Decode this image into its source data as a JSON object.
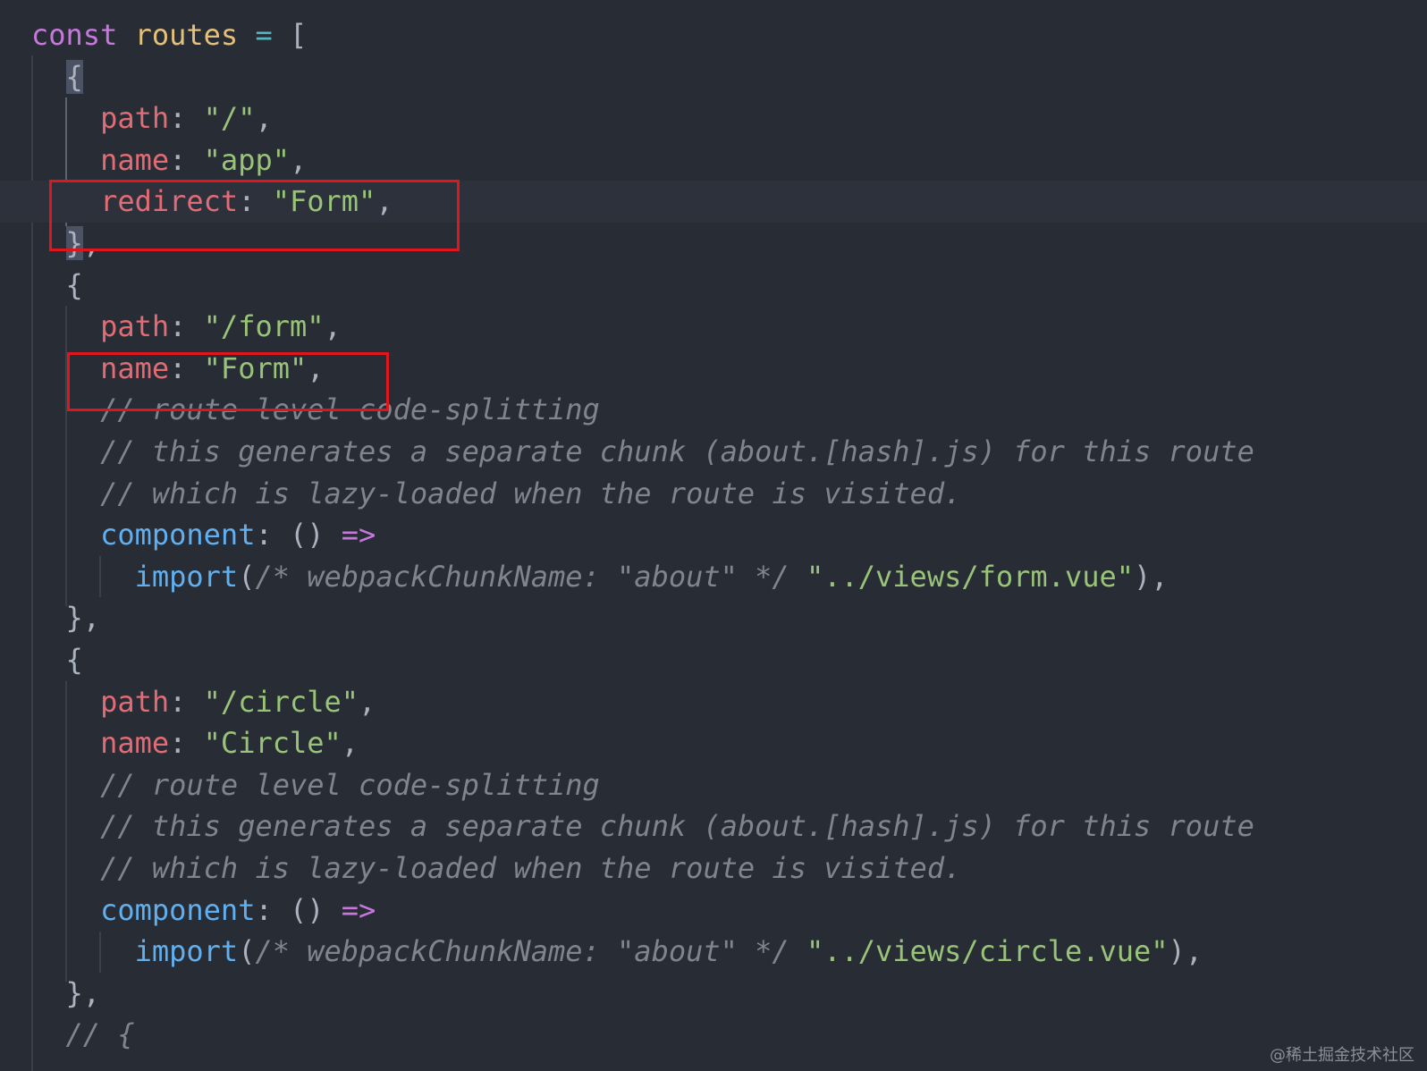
{
  "editor": {
    "language": "javascript",
    "theme_colors": {
      "background": "#282c34",
      "keyword": "#c678dd",
      "variable": "#e5c07b",
      "operator": "#56b6c2",
      "property": "#e06c75",
      "string": "#98c379",
      "function": "#61afef",
      "comment": "#7f848e",
      "highlight_box": "#e0161f"
    },
    "lines": [
      {
        "tokens": [
          {
            "t": "kw",
            "v": "const"
          },
          {
            "t": "punc",
            "v": " "
          },
          {
            "t": "var",
            "v": "routes"
          },
          {
            "t": "punc",
            "v": " "
          },
          {
            "t": "op",
            "v": "="
          },
          {
            "t": "punc",
            "v": " ["
          }
        ]
      },
      {
        "tokens": [
          {
            "t": "punc",
            "v": "  "
          },
          {
            "t": "bracket",
            "v": "{"
          }
        ]
      },
      {
        "tokens": [
          {
            "t": "punc",
            "v": "    "
          },
          {
            "t": "prop",
            "v": "path"
          },
          {
            "t": "punc",
            "v": ": "
          },
          {
            "t": "str",
            "v": "\"/\""
          },
          {
            "t": "punc",
            "v": ","
          }
        ]
      },
      {
        "tokens": [
          {
            "t": "punc",
            "v": "    "
          },
          {
            "t": "prop",
            "v": "name"
          },
          {
            "t": "punc",
            "v": ": "
          },
          {
            "t": "str",
            "v": "\"app\""
          },
          {
            "t": "punc",
            "v": ","
          }
        ]
      },
      {
        "tokens": [
          {
            "t": "punc",
            "v": "    "
          },
          {
            "t": "prop",
            "v": "redirect"
          },
          {
            "t": "punc",
            "v": ": "
          },
          {
            "t": "str",
            "v": "\"Form\""
          },
          {
            "t": "punc",
            "v": ","
          }
        ],
        "current": true
      },
      {
        "tokens": [
          {
            "t": "punc",
            "v": "  "
          },
          {
            "t": "bracket",
            "v": "}"
          },
          {
            "t": "punc",
            "v": ","
          }
        ]
      },
      {
        "tokens": [
          {
            "t": "punc",
            "v": "  {"
          }
        ]
      },
      {
        "tokens": [
          {
            "t": "punc",
            "v": "    "
          },
          {
            "t": "prop",
            "v": "path"
          },
          {
            "t": "punc",
            "v": ": "
          },
          {
            "t": "str",
            "v": "\"/form\""
          },
          {
            "t": "punc",
            "v": ","
          }
        ]
      },
      {
        "tokens": [
          {
            "t": "punc",
            "v": "    "
          },
          {
            "t": "prop",
            "v": "name"
          },
          {
            "t": "punc",
            "v": ": "
          },
          {
            "t": "str",
            "v": "\"Form\""
          },
          {
            "t": "punc",
            "v": ","
          }
        ]
      },
      {
        "tokens": [
          {
            "t": "punc",
            "v": "    "
          },
          {
            "t": "cm",
            "v": "// route level code-splitting"
          }
        ]
      },
      {
        "tokens": [
          {
            "t": "punc",
            "v": "    "
          },
          {
            "t": "cm",
            "v": "// this generates a separate chunk (about.[hash].js) for this route"
          }
        ]
      },
      {
        "tokens": [
          {
            "t": "punc",
            "v": "    "
          },
          {
            "t": "cm",
            "v": "// which is lazy-loaded when the route is visited."
          }
        ]
      },
      {
        "tokens": [
          {
            "t": "punc",
            "v": "    "
          },
          {
            "t": "fn",
            "v": "component"
          },
          {
            "t": "punc",
            "v": ": () "
          },
          {
            "t": "kw",
            "v": "=>"
          }
        ]
      },
      {
        "tokens": [
          {
            "t": "punc",
            "v": "      "
          },
          {
            "t": "fn",
            "v": "import"
          },
          {
            "t": "punc",
            "v": "("
          },
          {
            "t": "cm",
            "v": "/* webpackChunkName: \"about\" */"
          },
          {
            "t": "punc",
            "v": " "
          },
          {
            "t": "str",
            "v": "\"../views/form.vue\""
          },
          {
            "t": "punc",
            "v": "),"
          }
        ]
      },
      {
        "tokens": [
          {
            "t": "punc",
            "v": "  },"
          }
        ]
      },
      {
        "tokens": [
          {
            "t": "punc",
            "v": "  {"
          }
        ]
      },
      {
        "tokens": [
          {
            "t": "punc",
            "v": "    "
          },
          {
            "t": "prop",
            "v": "path"
          },
          {
            "t": "punc",
            "v": ": "
          },
          {
            "t": "str",
            "v": "\"/circle\""
          },
          {
            "t": "punc",
            "v": ","
          }
        ]
      },
      {
        "tokens": [
          {
            "t": "punc",
            "v": "    "
          },
          {
            "t": "prop",
            "v": "name"
          },
          {
            "t": "punc",
            "v": ": "
          },
          {
            "t": "str",
            "v": "\"Circle\""
          },
          {
            "t": "punc",
            "v": ","
          }
        ]
      },
      {
        "tokens": [
          {
            "t": "punc",
            "v": "    "
          },
          {
            "t": "cm",
            "v": "// route level code-splitting"
          }
        ]
      },
      {
        "tokens": [
          {
            "t": "punc",
            "v": "    "
          },
          {
            "t": "cm",
            "v": "// this generates a separate chunk (about.[hash].js) for this route"
          }
        ]
      },
      {
        "tokens": [
          {
            "t": "punc",
            "v": "    "
          },
          {
            "t": "cm",
            "v": "// which is lazy-loaded when the route is visited."
          }
        ]
      },
      {
        "tokens": [
          {
            "t": "punc",
            "v": "    "
          },
          {
            "t": "fn",
            "v": "component"
          },
          {
            "t": "punc",
            "v": ": () "
          },
          {
            "t": "kw",
            "v": "=>"
          }
        ]
      },
      {
        "tokens": [
          {
            "t": "punc",
            "v": "      "
          },
          {
            "t": "fn",
            "v": "import"
          },
          {
            "t": "punc",
            "v": "("
          },
          {
            "t": "cm",
            "v": "/* webpackChunkName: \"about\" */"
          },
          {
            "t": "punc",
            "v": " "
          },
          {
            "t": "str",
            "v": "\"../views/circle.vue\""
          },
          {
            "t": "punc",
            "v": "),"
          }
        ]
      },
      {
        "tokens": [
          {
            "t": "punc",
            "v": "  },"
          }
        ]
      },
      {
        "tokens": [
          {
            "t": "punc",
            "v": "  "
          },
          {
            "t": "cm",
            "v": "// {"
          }
        ]
      }
    ]
  },
  "watermark": "@稀土掘金技术社区"
}
